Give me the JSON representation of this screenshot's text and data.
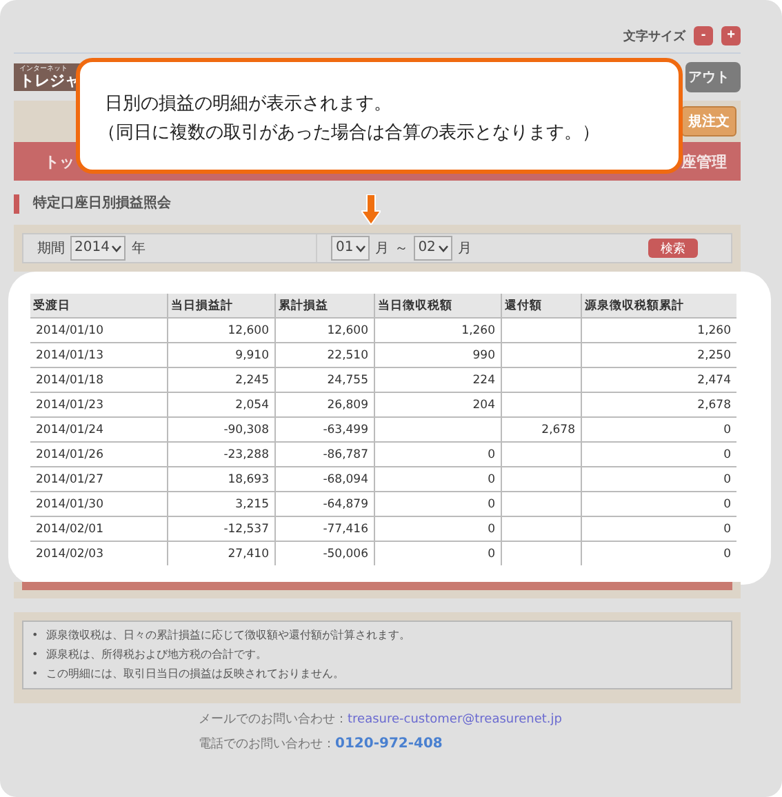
{
  "font_size": {
    "label": "文字サイズ",
    "buttons": [
      "-",
      "+"
    ]
  },
  "header": {
    "logo_small": "インターネット",
    "logo": "トレジャ",
    "logout": "アウト",
    "new_order": "規注文"
  },
  "nav": [
    "トッ",
    "座管理"
  ],
  "callout": [
    "日別の損益の明細が表示されます。",
    "（同日に複数の取引があった場合は合算の表示となります。）"
  ],
  "page_title": "特定口座日別損益照会",
  "search": {
    "label": "期間",
    "year": "2014",
    "year_unit": "年",
    "from_month": "01",
    "month_unit_1": "月",
    "tilde": "～",
    "to_month": "02",
    "month_unit_2": "月",
    "button": "検索"
  },
  "table": {
    "columns": [
      "受渡日",
      "当日損益計",
      "累計損益",
      "当日徴収税額",
      "還付額",
      "源泉徴収税額累計"
    ],
    "rows": [
      [
        "2014/01/10",
        "12,600",
        "12,600",
        "1,260",
        "",
        "1,260"
      ],
      [
        "2014/01/13",
        "9,910",
        "22,510",
        "990",
        "",
        "2,250"
      ],
      [
        "2014/01/18",
        "2,245",
        "24,755",
        "224",
        "",
        "2,474"
      ],
      [
        "2014/01/23",
        "2,054",
        "26,809",
        "204",
        "",
        "2,678"
      ],
      [
        "2014/01/24",
        "-90,308",
        "-63,499",
        "",
        "2,678",
        "0"
      ],
      [
        "2014/01/26",
        "-23,288",
        "-86,787",
        "0",
        "",
        "0"
      ],
      [
        "2014/01/27",
        "18,693",
        "-68,094",
        "0",
        "",
        "0"
      ],
      [
        "2014/01/30",
        "3,215",
        "-64,879",
        "0",
        "",
        "0"
      ],
      [
        "2014/02/01",
        "-12,537",
        "-77,416",
        "0",
        "",
        "0"
      ],
      [
        "2014/02/03",
        "27,410",
        "-50,006",
        "0",
        "",
        "0"
      ]
    ]
  },
  "notes": [
    {
      "marker": "•",
      "text": "源泉徴収税は、日々の累計損益に応じて徴収額や還付額が計算されます。"
    },
    {
      "marker": "•",
      "text": "源泉税は、所得税および地方税の合計です。"
    },
    {
      "marker": "•",
      "text": "この明細には、取引日当日の損益は反映されておりません。"
    }
  ],
  "footer": {
    "email_label": "メールでのお問い合わせ：",
    "email": "treasure-customer@treasurenet.jp",
    "phone_label": "電話でのお問い合わせ：",
    "phone": "0120-972-408"
  }
}
